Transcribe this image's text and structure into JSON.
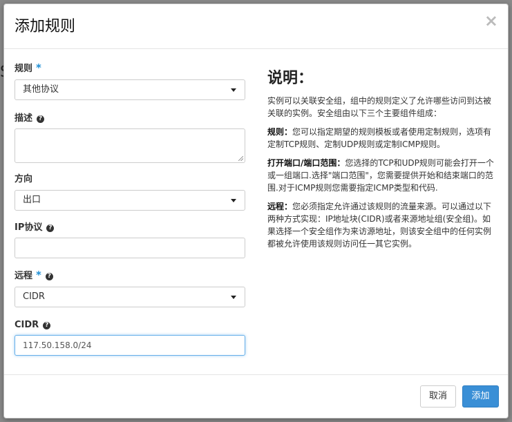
{
  "backdrop": {
    "partial_char": "S"
  },
  "modal": {
    "title": "添加规则",
    "close_glyph": "×"
  },
  "form": {
    "rule": {
      "label": "规则",
      "selected": "其他协议"
    },
    "description": {
      "label": "描述",
      "value": ""
    },
    "direction": {
      "label": "方向",
      "selected": "出口"
    },
    "ip_protocol": {
      "label": "IP协议",
      "value": ""
    },
    "remote": {
      "label": "远程",
      "selected": "CIDR"
    },
    "cidr": {
      "label": "CIDR",
      "value": "117.50.158.0/24"
    },
    "required_marker": "*",
    "help_glyph": "?"
  },
  "description_panel": {
    "title": "说明：",
    "intro": "实例可以关联安全组，组中的规则定义了允许哪些访问到达被关联的实例。安全组由以下三个主要组件组成：",
    "rule_heading": "规则：",
    "rule_text": "您可以指定期望的规则模板或者使用定制规则，选项有定制TCP规则、定制UDP规则或定制ICMP规则。",
    "port_heading": "打开端口/端口范围：",
    "port_text": "您选择的TCP和UDP规则可能会打开一个或一组端口.选择\"端口范围\"，您需要提供开始和结束端口的范围.对于ICMP规则您需要指定ICMP类型和代码.",
    "remote_heading": "远程：",
    "remote_text": "您必须指定允许通过该规则的流量来源。可以通过以下两种方式实现：IP地址块(CIDR)或者来源地址组(安全组)。如果选择一个安全组作为来访源地址，则该安全组中的任何实例都被允许使用该规则访问任一其它实例。"
  },
  "footer": {
    "cancel_label": "取消",
    "add_label": "添加"
  },
  "colors": {
    "primary": "#3a8fd6",
    "required": "#1f8fd6",
    "focus_border": "#66afe9"
  }
}
